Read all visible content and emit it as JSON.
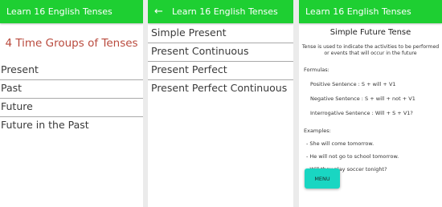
{
  "screen_a": {
    "appbar_title": "Learn 16 English Tenses",
    "heading": "4 Time Groups of Tenses",
    "groups": [
      "Present",
      "Past",
      "Future",
      "Future in the Past"
    ]
  },
  "screen_b": {
    "appbar_title": "Learn 16 English Tenses",
    "back_icon": "←",
    "tenses": [
      "Simple Present",
      "Present Continuous",
      "Present Perfect",
      "Present Perfect Continuous"
    ]
  },
  "screen_c": {
    "appbar_title": "Learn 16 English Tenses",
    "tense_title": "Simple Future Tense",
    "definition": "Tense is used to indicate the activities to be performed or events that will occur in the future",
    "formulas_label": "Formulas:",
    "formulas": [
      "Positive Sentence : S + will + V1",
      "Negative Sentence : S + will + not + V1",
      "Interrogative Sentence : Will + S + V1?"
    ],
    "examples_label": "Examples:",
    "examples": [
      "- She will come tomorrow.",
      "- He will not go to school tomorrow.",
      "- Will they play soccer tonight?"
    ],
    "menu_button": "MENU"
  },
  "colors": {
    "appbar": "#1ecf32",
    "heading": "#b94a3d",
    "menu_button": "#19d6c2"
  }
}
